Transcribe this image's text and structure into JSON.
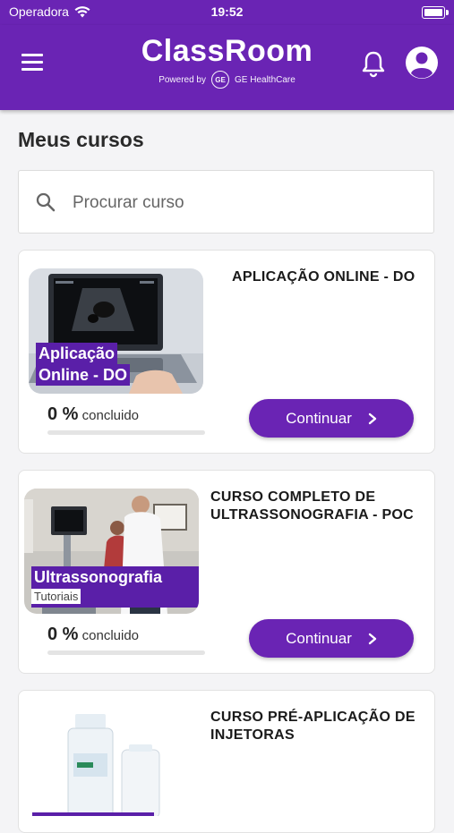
{
  "status_bar": {
    "carrier": "Operadora",
    "time": "19:52"
  },
  "header": {
    "brand_title": "ClassRoom",
    "powered_by": "Powered by",
    "partner": "GE HealthCare",
    "partner_logo_text": "GE"
  },
  "main": {
    "section_title": "Meus cursos",
    "search": {
      "placeholder": "Procurar curso",
      "value": ""
    },
    "courses": [
      {
        "title": "APLICAÇÃO ONLINE - DO",
        "thumb_label_1": "Aplicação",
        "thumb_label_2": "Online - DO",
        "progress_value": "0 %",
        "progress_label": "concluido",
        "progress_fraction": 0,
        "button_label": "Continuar"
      },
      {
        "title_1": "CURSO COMPLETO DE",
        "title_2": "ULTRASSONOGRAFIA - POC",
        "thumb_label": "Ultrassonografia PoC",
        "thumb_tag": "Tutoriais",
        "progress_value": "0 %",
        "progress_label": "concluido",
        "progress_fraction": 0,
        "button_label": "Continuar"
      },
      {
        "title_1": "CURSO PRÉ-APLICAÇÃO DE",
        "title_2": "INJETORAS"
      }
    ]
  },
  "colors": {
    "primary": "#6a24b4",
    "background": "#f4f4f6",
    "card": "#ffffff"
  },
  "icons": [
    "wifi-icon",
    "battery-icon",
    "menu-icon",
    "bell-icon",
    "user-avatar-icon",
    "search-icon",
    "chevron-right-icon"
  ]
}
